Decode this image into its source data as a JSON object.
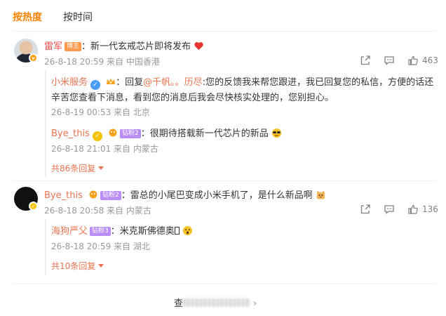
{
  "tabs": [
    {
      "label": "按热度"
    },
    {
      "label": "按时间"
    }
  ],
  "comments": [
    {
      "user": "雷军",
      "user_tag": "博主",
      "text": "：新一代玄戒芯片即将发布",
      "emoji": "heart-icon",
      "meta": "26-8-18 20:59 来自 中国香港",
      "likes": "463",
      "replies": [
        {
          "user": "小米服务",
          "prefix": "：回复",
          "mention": "@千帆。。历尽",
          "text_line1": ":您的反馈我来帮您跟进，我已回复您的私信，方便的话还",
          "text_line2": "辛苦您查看下消息，看到您的消息后我会尽快核实处理的，您别担心。",
          "meta": "26-8-19 00:53 来自 北京"
        },
        {
          "user": "Bye_this",
          "user_tag": "钻粉2",
          "text": "：很期待搭载新一代芯片的新品",
          "emoji": "sunglasses-icon",
          "meta": "26-8-18 21:01 来自 内蒙古"
        }
      ],
      "more_replies": "共86条回复"
    },
    {
      "user": "Bye_this",
      "user_tag": "钻粉2",
      "text": "：雷总的小尾巴变成小米手机了，是什么新品啊",
      "emoji": "cat-icon",
      "meta": "26-8-18 20:58 来自 内蒙古",
      "likes": "136",
      "replies": [
        {
          "user": "海狗严父",
          "user_tag": "钻粉3",
          "text": "：米克斯佛德奥",
          "emoji": "surprised-icon",
          "meta": "26-8-18 20:59 来自 湖北"
        }
      ],
      "more_replies": "共10条回复"
    }
  ],
  "view_all": {
    "prefix": "查",
    "suffix": "›"
  },
  "colors": {
    "accent": "#ff8200",
    "username": "#eb7350",
    "meta": "#999999"
  }
}
